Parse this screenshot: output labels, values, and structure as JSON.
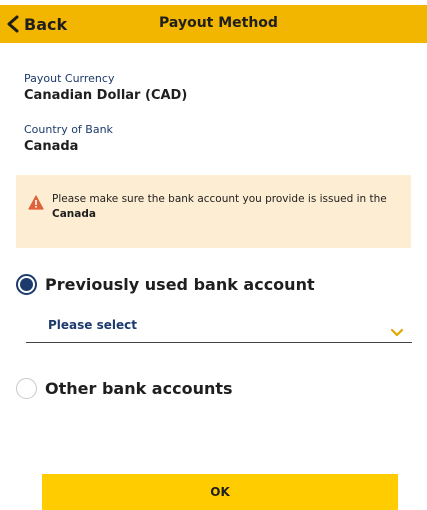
{
  "header": {
    "back_label": "Back",
    "title": "Payout Method",
    "background": "#f2b500"
  },
  "fields": {
    "currency_label": "Payout Currency",
    "currency_value": "Canadian Dollar (CAD)",
    "country_label": "Country of Bank",
    "country_value": "Canada"
  },
  "notice": {
    "icon": "warning-triangle-icon",
    "text": "Please make sure the bank account you provide is issued in the",
    "country": "Canada",
    "background": "#fdedd2"
  },
  "options": {
    "previous_label": "Previously used bank account",
    "previous_selected": true,
    "select_placeholder": "Please select",
    "other_label": "Other bank accounts",
    "other_selected": false
  },
  "ok_button": {
    "label": "OK",
    "color": "#ffcc00"
  },
  "colors": {
    "accent_navy": "#1c3a6b",
    "warning_icon": "#e0623a"
  }
}
